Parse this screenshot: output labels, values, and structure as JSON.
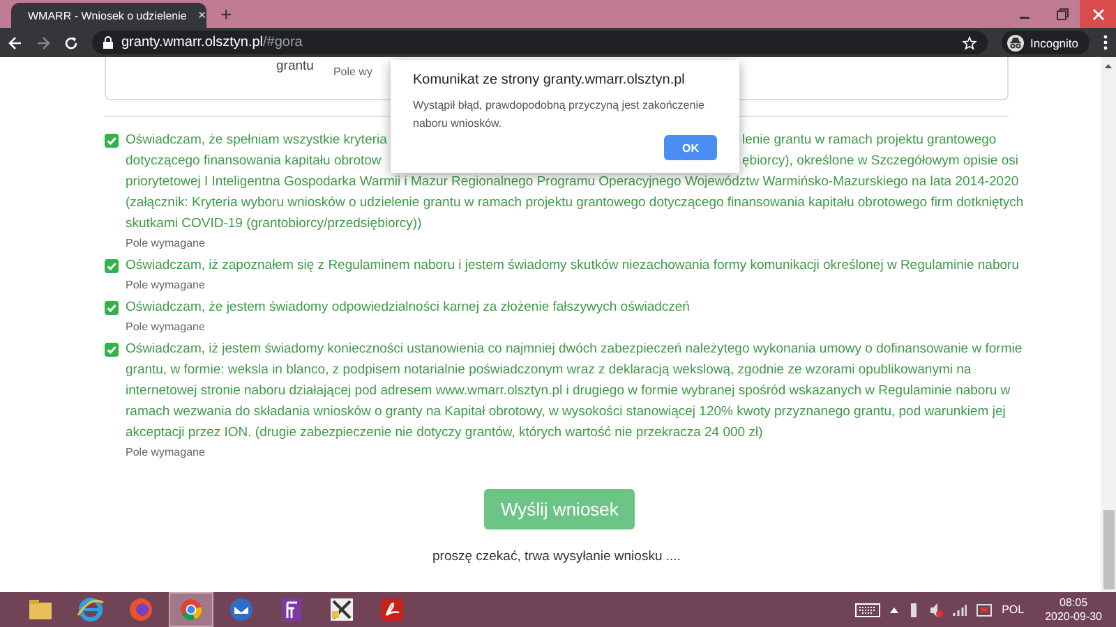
{
  "browser": {
    "tab": {
      "title": "WMARR - Wniosek o udzielenie",
      "close": "×"
    },
    "new_tab": "+",
    "url": {
      "host": "granty.wmarr.olsztyn.pl",
      "fragment": "/#gora"
    },
    "profile": "Incognito"
  },
  "form_top": {
    "label": "grantu",
    "hint": "Pole wy"
  },
  "declarations": [
    {
      "kind": "partly_covered",
      "checked": true,
      "covered_lines": [
        {
          "before": "Oświadczam, że spełniam wszystkie kryteria",
          "after": "lenie grantu w ramach projektu grantowego"
        },
        {
          "before": "dotyczącego finansowania kapitału obrotow",
          "after": "ębiorcy), określone w Szczegółowym opisie osi"
        }
      ],
      "text": "priorytetowej I Inteligentna Gospodarka Warmii i Mazur Regionalnego Programu Operacyjnego Województw Warmińsko-Mazurskiego na lata 2014-2020 (załącznik: Kryteria wyboru wniosków o udzielenie grantu w ramach projektu grantowego dotyczącego finansowania kapitału obrotowego firm dotkniętych skutkami COVID-19 (grantobiorcy/przedsiębiorcy))",
      "hint": "Pole wymagane"
    },
    {
      "kind": "plain",
      "checked": true,
      "text": "Oświadczam, iż zapoznałem się z Regulaminem naboru i jestem świadomy skutków niezachowania formy komunikacji określonej w Regulaminie naboru",
      "hint": "Pole wymagane"
    },
    {
      "kind": "plain",
      "checked": true,
      "text": "Oświadczam, że jestem świadomy odpowiedzialności karnej za złożenie fałszywych oświadczeń",
      "hint": "Pole wymagane"
    },
    {
      "kind": "plain",
      "checked": true,
      "text": "Oświadczam, iż jestem świadomy konieczności ustanowienia co najmniej dwóch zabezpieczeń należytego wykonania umowy o dofinansowanie w formie grantu, w formie: weksla in blanco, z podpisem notarialnie poświadczonym wraz z deklaracją wekslową, zgodnie ze wzorami opublikowanymi na internetowej stronie naboru działającej pod adresem www.wmarr.olsztyn.pl i drugiego w formie wybranej spośród wskazanych w Regulaminie naboru w ramach wezwania do składania wniosków o granty na Kapitał obrotowy, w wysokości stanowiącej 120% kwoty przyznanego grantu, pod warunkiem jej akceptacji przez ION. (drugie zabezpieczenie nie dotyczy grantów, których wartość nie przekracza 24 000 zł)",
      "hint": "Pole wymagane"
    }
  ],
  "submit_button": "Wyślij wniosek",
  "status": "proszę czekać, trwa wysyłanie wniosku ....",
  "dialog": {
    "title": "Komunikat ze strony granty.wmarr.olsztyn.pl",
    "message": "Wystąpił błąd, prawdopodobną przyczyną jest zakończenie naboru wniosków.",
    "button": "OK"
  },
  "taskbar": {
    "apps": [
      {
        "kind": "folder",
        "selected": false
      },
      {
        "kind": "ie",
        "selected": false
      },
      {
        "kind": "firefox",
        "selected": false
      },
      {
        "kind": "chrome",
        "selected": true
      },
      {
        "kind": "mail",
        "selected": false
      },
      {
        "kind": "purple",
        "selected": false
      },
      {
        "kind": "tool",
        "selected": false
      },
      {
        "kind": "pdf",
        "selected": false
      }
    ],
    "language": "POL",
    "time": "08:05",
    "date": "2020-09-30"
  }
}
